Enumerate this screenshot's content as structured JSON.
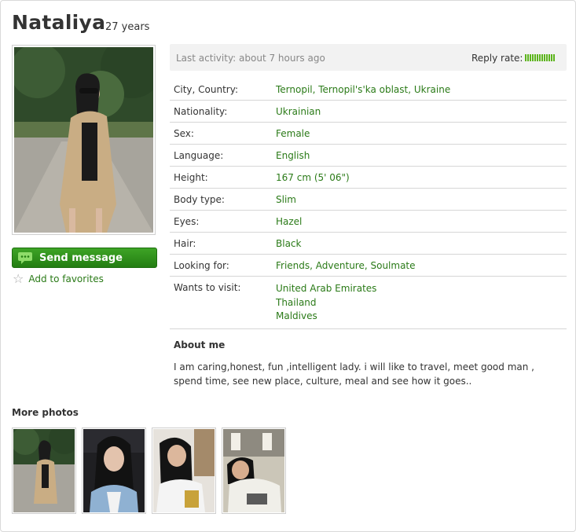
{
  "profile": {
    "name": "Nataliya",
    "age": "27 years"
  },
  "actions": {
    "send_message": "Send message",
    "add_favorites": "Add to favorites"
  },
  "activity": {
    "last_activity": "Last activity: about 7 hours ago",
    "reply_rate_label": "Reply rate:",
    "reply_rate_level": 1.0
  },
  "details": [
    {
      "label": "City, Country:",
      "value": "Ternopil, Ternopil's'ka oblast, Ukraine"
    },
    {
      "label": "Nationality:",
      "value": "Ukrainian"
    },
    {
      "label": "Sex:",
      "value": "Female"
    },
    {
      "label": "Language:",
      "value": "English"
    },
    {
      "label": "Height:",
      "value": "167 cm (5' 06\")"
    },
    {
      "label": "Body type:",
      "value": "Slim"
    },
    {
      "label": "Eyes:",
      "value": "Hazel"
    },
    {
      "label": "Hair:",
      "value": "Black"
    },
    {
      "label": "Looking for:",
      "value": "Friends, Adventure, Soulmate"
    }
  ],
  "wants_to_visit": {
    "label": "Wants to visit:",
    "values": [
      "United Arab Emirates",
      "Thailand",
      "Maldives"
    ]
  },
  "about": {
    "title": "About me",
    "text": "I am caring,honest, fun ,intelligent lady. i will like to travel, meet good man , spend time, see new place, culture, meal and see how it goes.."
  },
  "more_photos": {
    "title": "More photos"
  },
  "colors": {
    "accent_green": "#2a7a17",
    "button_green": "#2e8f1b",
    "reply_rate_green": "#5cb41c"
  }
}
